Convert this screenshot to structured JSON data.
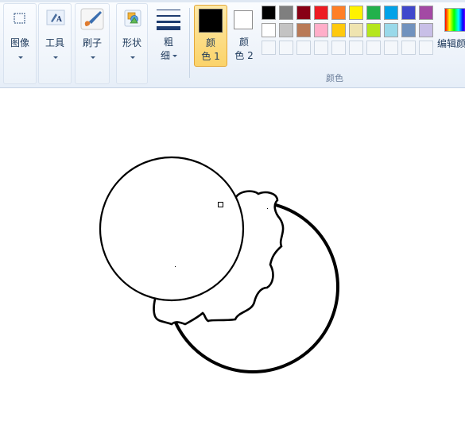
{
  "ribbon": {
    "image_label": "图像",
    "tools_label": "工具",
    "brush_label": "刷子",
    "shapes_label": "形状",
    "size_label_1": "粗",
    "size_label_2": "细",
    "color1_label_1": "颜",
    "color1_label_2": "色 1",
    "color2_label_1": "颜",
    "color2_label_2": "色 2",
    "edit_colors_label": "编辑颜",
    "colors_group_label": "颜色"
  },
  "colors": {
    "color1": "#000000",
    "color2": "#ffffff",
    "palette_row1": [
      "#000000",
      "#7f7f7f",
      "#880015",
      "#ed1c24",
      "#ff7f27",
      "#fff200",
      "#22b14c",
      "#00a2e8",
      "#3f48cc",
      "#a349a4"
    ],
    "palette_row2": [
      "#ffffff",
      "#c3c3c3",
      "#b97a57",
      "#ffaec9",
      "#ffc90e",
      "#efe4b0",
      "#b5e61d",
      "#99d9ea",
      "#7092be",
      "#c8bfe7"
    ]
  }
}
